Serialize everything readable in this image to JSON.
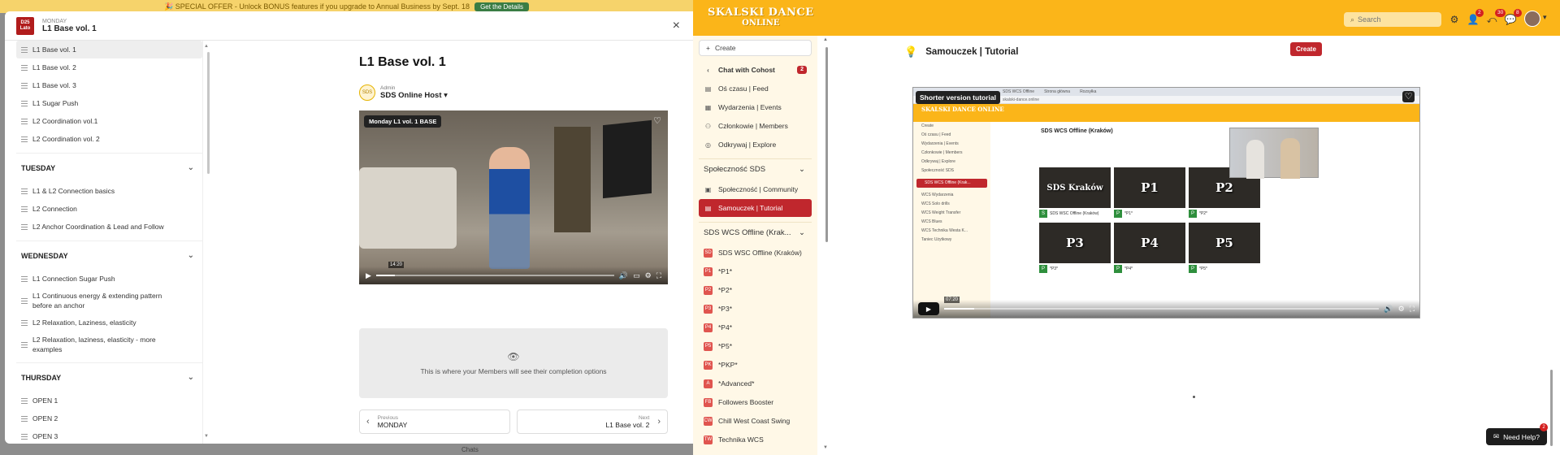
{
  "bg": {
    "promo_text": "🎉 SPECIAL OFFER - Unlock BONUS features if you upgrade to Annual Business by Sept. 18",
    "promo_button": "Get the Details",
    "footer_text": "Chats"
  },
  "modal": {
    "logo_text": "D25 Lato",
    "subtitle": "MONDAY",
    "title": "L1 Base vol. 1",
    "close": "×",
    "groups": [
      {
        "name": "",
        "items": [
          "L1 Base vol. 1",
          "L1 Base vol. 2",
          "L1 Base vol. 3",
          "L1 Sugar Push",
          "L2 Coordination vol.1",
          "L2 Coordination vol. 2"
        ]
      },
      {
        "name": "TUESDAY",
        "items": [
          "L1 & L2 Connection basics",
          "L2 Connection",
          "L2 Anchor Coordination & Lead and Follow"
        ]
      },
      {
        "name": "WEDNESDAY",
        "items": [
          "L1 Connection Sugar Push",
          "L1 Continuous energy & extending pattern before an anchor",
          "L2 Relaxation, Laziness, elasticity",
          "L2 Relaxation, laziness, elasticity - more examples"
        ]
      },
      {
        "name": "THURSDAY",
        "items": [
          "OPEN 1",
          "OPEN 2",
          "OPEN 3"
        ]
      }
    ],
    "lesson": {
      "title": "L1 Base vol. 1",
      "author_role": "Admin",
      "author_name": "SDS Online Host",
      "video_label": "Monday L1 vol. 1 BASE",
      "video_time": "14:20",
      "video_progress": 0.08,
      "completion_text": "This is where your Members will see their completion options",
      "prev_label": "Previous",
      "prev_value": "MONDAY",
      "next_label": "Next",
      "next_value": "L1 Base vol. 2"
    }
  },
  "topbar": {
    "brand_line1": "SKALSKI DANCE",
    "brand_line2": "ONLINE",
    "search_placeholder": "Search",
    "badge_people": "2",
    "badge_activity": "30",
    "badge_chat": "8"
  },
  "sidenav": {
    "create_label": "Create",
    "items": [
      {
        "label": "Chat with Cohost",
        "icon": "chevron-left-icon",
        "count": "2"
      },
      {
        "label": "Oś czasu | Feed",
        "icon": "feed-icon"
      },
      {
        "label": "Wydarzenia | Events",
        "icon": "calendar-icon"
      },
      {
        "label": "Członkowie | Members",
        "icon": "members-icon"
      },
      {
        "label": "Odkrywaj | Explore",
        "icon": "compass-icon"
      }
    ],
    "section1": "Społeczność SDS",
    "section1_items": [
      "Społeczność | Community",
      "Samouczek | Tutorial"
    ],
    "section2": "SDS WCS Offline (Krak...",
    "section2_items": [
      {
        "label": "SDS WSC Offline (Kraków)",
        "tag": "SDS"
      },
      {
        "label": "*P1*",
        "tag": "P1"
      },
      {
        "label": "*P2*",
        "tag": "P2"
      },
      {
        "label": "*P3*",
        "tag": "P3"
      },
      {
        "label": "*P4*",
        "tag": "P4"
      },
      {
        "label": "*P5*",
        "tag": "P5"
      },
      {
        "label": "*PKP*",
        "tag": "PKP"
      },
      {
        "label": "*Advanced*",
        "tag": "A"
      },
      {
        "label": "Followers Booster",
        "tag": "FB"
      },
      {
        "label": "Chill West Coast Swing",
        "tag": "CW"
      },
      {
        "label": "Technika WCS",
        "tag": "TW"
      }
    ]
  },
  "main": {
    "page_title": "Samouczek | Tutorial",
    "create_button": "Create",
    "video_label": "Shorter version tutorial",
    "video_time": "07:20",
    "video_progress": 0.07,
    "inner": {
      "brand": "SKALSKI DANCE ONLINE",
      "heading": "SDS WCS Offline (Kraków)",
      "side": [
        "Create",
        "Oś czasu | Feed",
        "Wydarzenia | Events",
        "Członkowie | Members",
        "Odkrywaj | Explore",
        "Społeczność SDS",
        "SDS WCS Offline (Krak...",
        "WCS Wydarzenia",
        "WCS Solo drills",
        "WCS Weight Transfer",
        "WCS Blues",
        "WCS Technika Westa K...",
        "Taniec Użytkowy"
      ],
      "tiles": [
        {
          "title": "SDS Kraków",
          "cap": "SDS WSC Offline (Kraków)"
        },
        {
          "title": "P1",
          "cap": "*P1*"
        },
        {
          "title": "P2",
          "cap": "*P2*"
        },
        {
          "title": "P3",
          "cap": "*P3*"
        },
        {
          "title": "P4",
          "cap": "*P4*"
        },
        {
          "title": "P5",
          "cap": "*P5*"
        }
      ]
    },
    "help": "Need Help?",
    "help_badge": "2"
  }
}
